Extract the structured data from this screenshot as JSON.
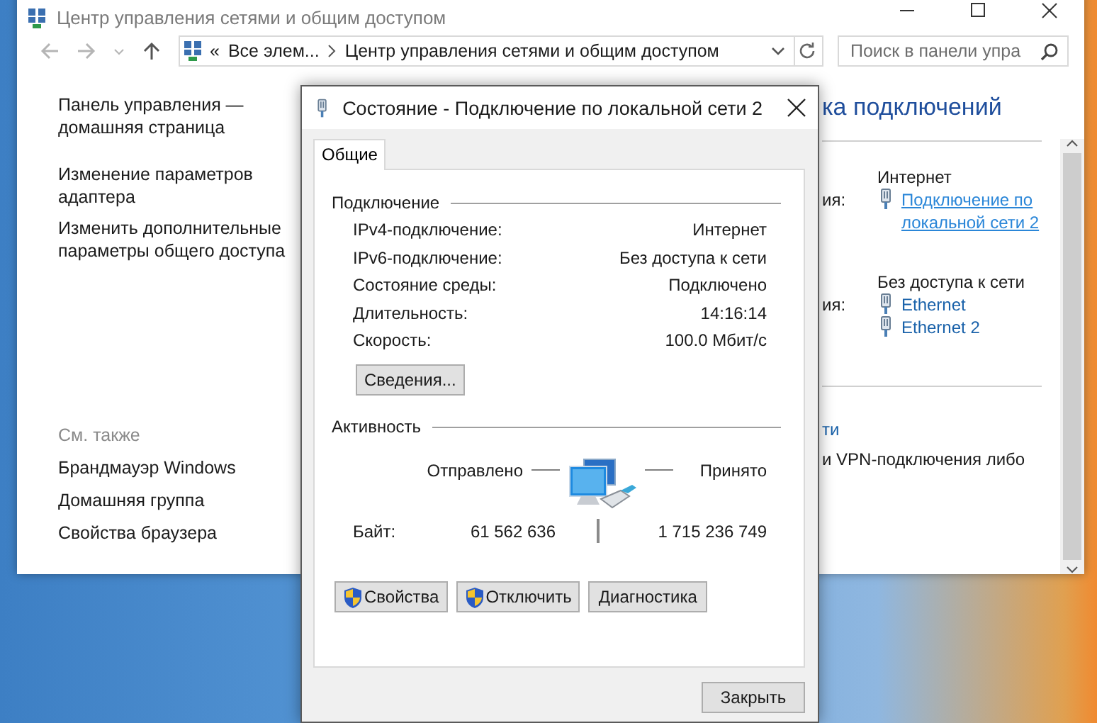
{
  "window": {
    "title": "Центр управления сетями и общим доступом"
  },
  "address_bar": {
    "overflow": "«",
    "crumbs": [
      "Все элем...",
      "Центр управления сетями и общим доступом"
    ]
  },
  "search": {
    "placeholder": "Поиск в панели упра"
  },
  "sidebar": {
    "links": [
      "Панель управления — домашняя страница",
      "Изменение параметров адаптера",
      "Изменить дополнительные параметры общего доступа"
    ],
    "see_also_heading": "См. также",
    "see_also": [
      "Брандмауэр Windows",
      "Домашняя группа",
      "Свойства браузера"
    ]
  },
  "content": {
    "heading_fragment": "ка подключений",
    "networks": [
      {
        "label_fragment": "ия:",
        "access": "Интернет",
        "connections": [
          {
            "name": "Подключение по локальной сети 2",
            "hovered": true
          }
        ]
      },
      {
        "label_fragment": "ия:",
        "access": "Без доступа к сети",
        "connections": [
          {
            "name": "Ethernet",
            "hovered": false
          },
          {
            "name": "Ethernet 2",
            "hovered": false
          }
        ]
      }
    ],
    "change_link_fragment": "ти",
    "change_text_fragment": "и VPN-подключения либо"
  },
  "dialog": {
    "title": "Состояние - Подключение по локальной сети 2",
    "tabs": [
      {
        "label": "Общие",
        "selected": true
      }
    ],
    "connection": {
      "heading": "Подключение",
      "rows": [
        {
          "label": "IPv4-подключение:",
          "value": "Интернет"
        },
        {
          "label": "IPv6-подключение:",
          "value": "Без доступа к сети"
        },
        {
          "label": "Состояние среды:",
          "value": "Подключено"
        },
        {
          "label": "Длительность:",
          "value": "14:16:14"
        },
        {
          "label": "Скорость:",
          "value": "100.0 Мбит/с"
        }
      ],
      "details_button": "Сведения..."
    },
    "activity": {
      "heading": "Активность",
      "sent_label": "Отправлено",
      "received_label": "Принято",
      "bytes_label": "Байт:",
      "sent": "61 562 636",
      "received": "1 715 236 749"
    },
    "buttons": [
      {
        "label": "Свойства",
        "kind": "shield"
      },
      {
        "label": "Отключить",
        "kind": "shield"
      },
      {
        "label": "Диагностика",
        "kind": "plain"
      }
    ],
    "close_button": "Закрыть"
  }
}
